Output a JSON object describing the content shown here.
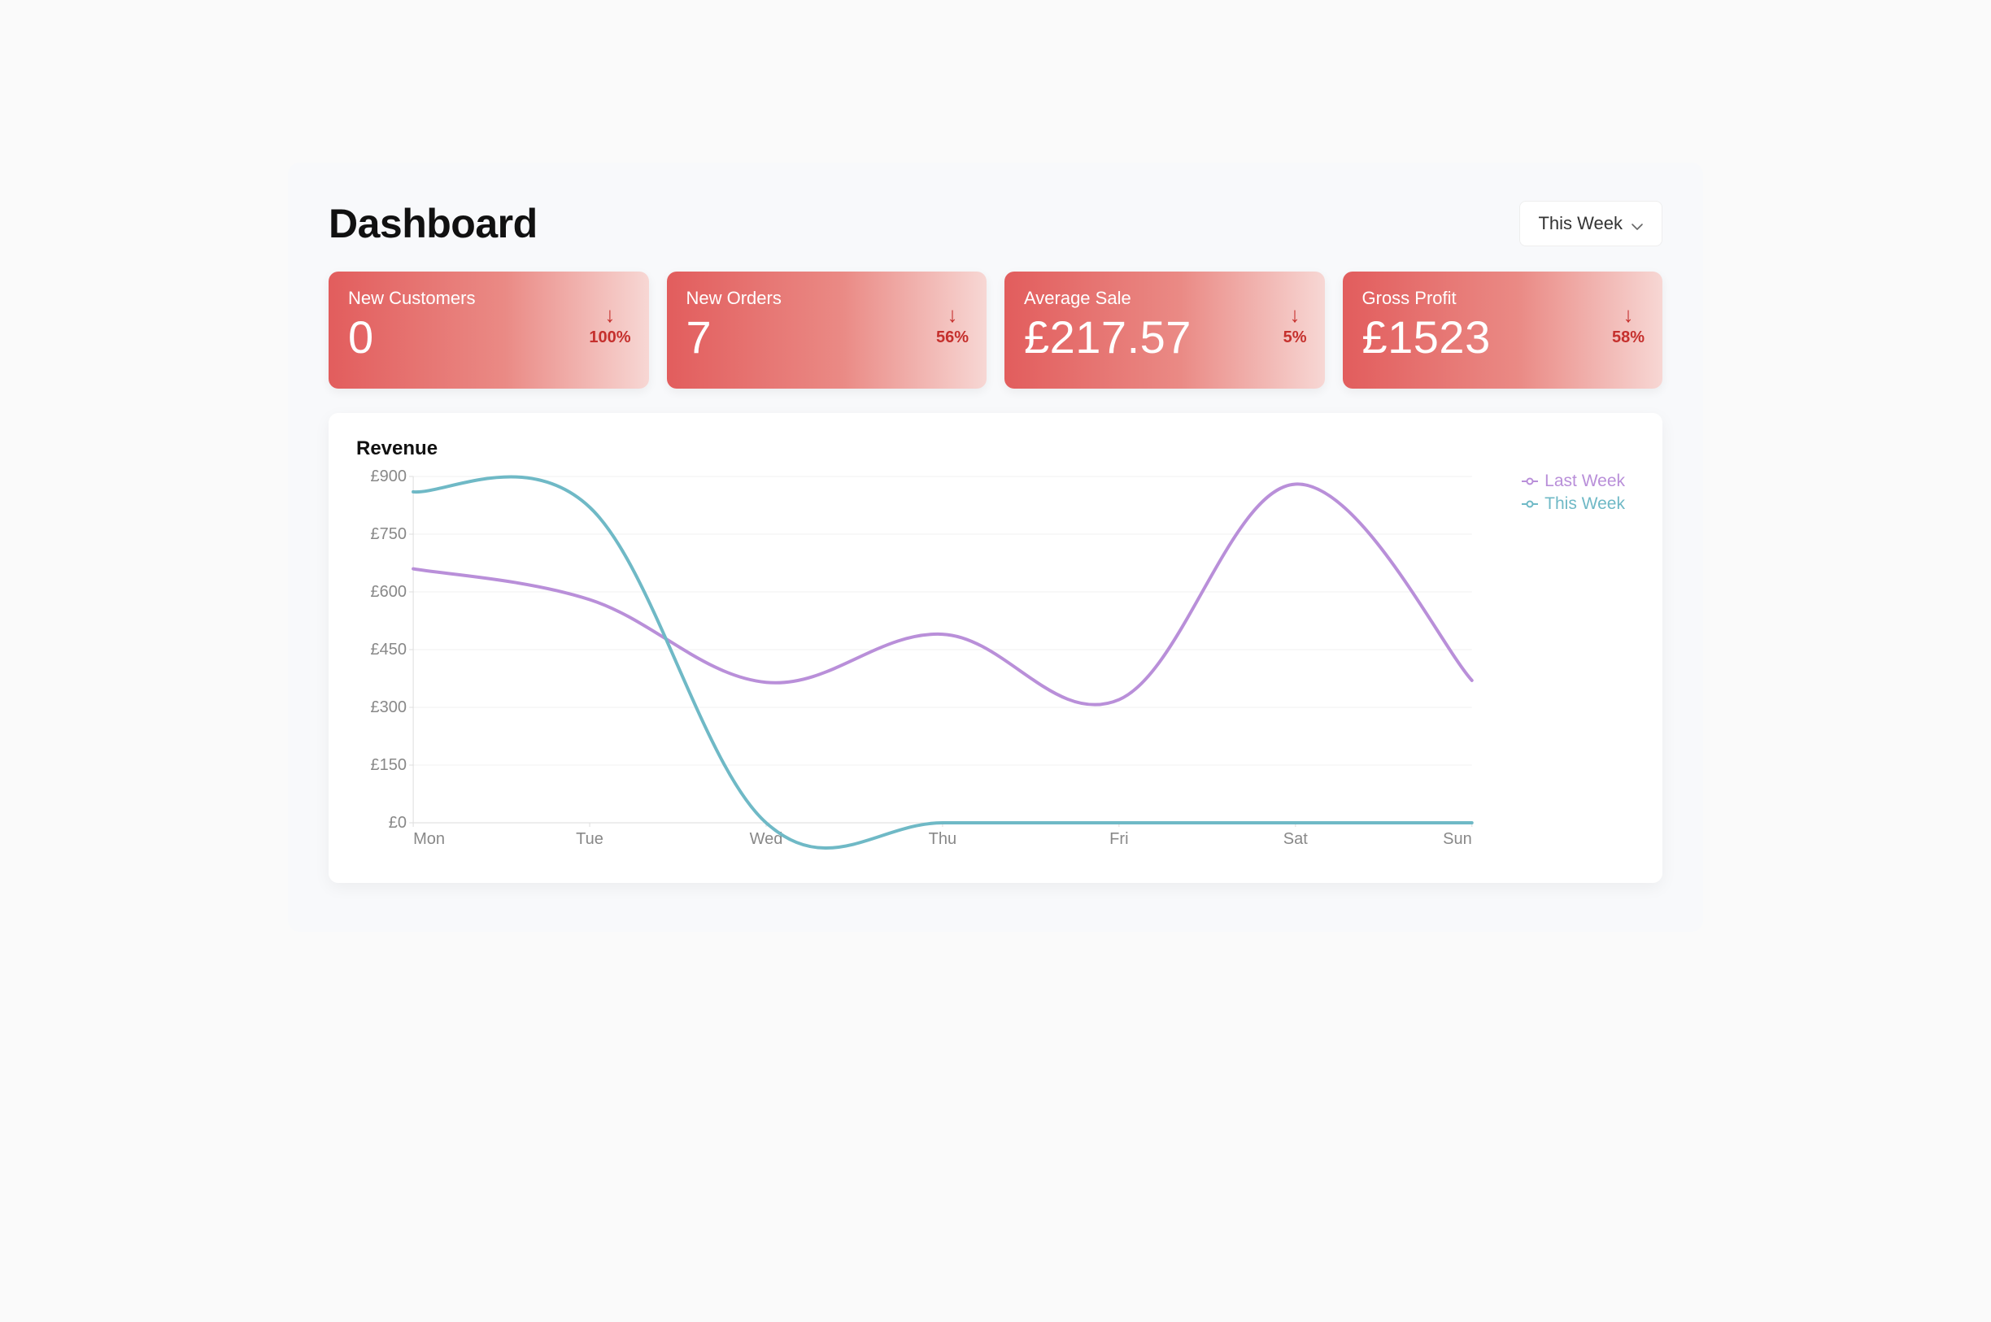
{
  "header": {
    "title": "Dashboard",
    "dropdown_label": "This Week"
  },
  "cards": [
    {
      "label": "New Customers",
      "value": "0",
      "trend_dir": "down",
      "trend_pct": "100%"
    },
    {
      "label": "New Orders",
      "value": "7",
      "trend_dir": "down",
      "trend_pct": "56%"
    },
    {
      "label": "Average Sale",
      "value": "£217.57",
      "trend_dir": "down",
      "trend_pct": "5%"
    },
    {
      "label": "Gross Profit",
      "value": "£1523",
      "trend_dir": "down",
      "trend_pct": "58%"
    }
  ],
  "chart": {
    "title": "Revenue",
    "legend": {
      "last_week": "Last Week",
      "this_week": "This Week"
    }
  },
  "colors": {
    "last_week": "#b98fd9",
    "this_week": "#6fb9c6"
  },
  "chart_data": {
    "type": "line",
    "title": "Revenue",
    "xlabel": "",
    "ylabel": "",
    "categories": [
      "Mon",
      "Tue",
      "Wed",
      "Thu",
      "Fri",
      "Sat",
      "Sun"
    ],
    "y_ticks": [
      0,
      150,
      300,
      450,
      600,
      750,
      900
    ],
    "y_tick_labels": [
      "£0",
      "£150",
      "£300",
      "£450",
      "£600",
      "£750",
      "£900"
    ],
    "ylim": [
      0,
      900
    ],
    "series": [
      {
        "name": "Last Week",
        "color": "#b98fd9",
        "values": [
          660,
          580,
          365,
          490,
          320,
          880,
          370
        ]
      },
      {
        "name": "This Week",
        "color": "#6fb9c6",
        "values": [
          860,
          820,
          0,
          0,
          0,
          0,
          0
        ]
      }
    ]
  }
}
